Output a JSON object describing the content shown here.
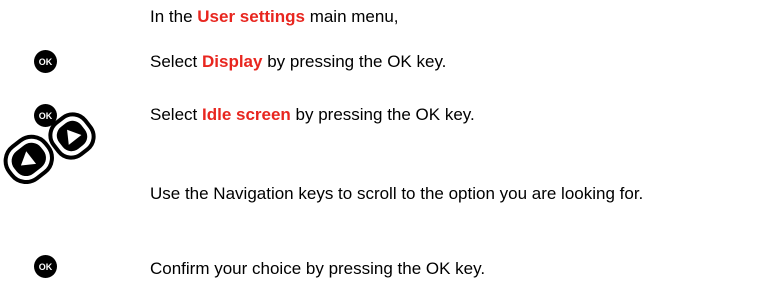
{
  "steps": [
    {
      "before": "In the ",
      "highlight": "User settings",
      "after": " main menu,",
      "icon": null
    },
    {
      "before": "Select ",
      "highlight": "Display",
      "after": " by pressing the OK key.",
      "icon": "ok-key-icon"
    },
    {
      "before": "Select ",
      "highlight": "Idle screen",
      "after": " by pressing the OK key.",
      "icon": "ok-key-icon"
    },
    {
      "text": "Use the Navigation keys to scroll to the option you are looking for.",
      "icon": "navigation-keys-icon"
    },
    {
      "text": "Confirm your choice by pressing the OK key.",
      "icon": "ok-key-icon"
    }
  ],
  "ok_key_label": "OK",
  "colors": {
    "highlight": "#e8261f",
    "text": "#000000",
    "icon": "#000000"
  }
}
